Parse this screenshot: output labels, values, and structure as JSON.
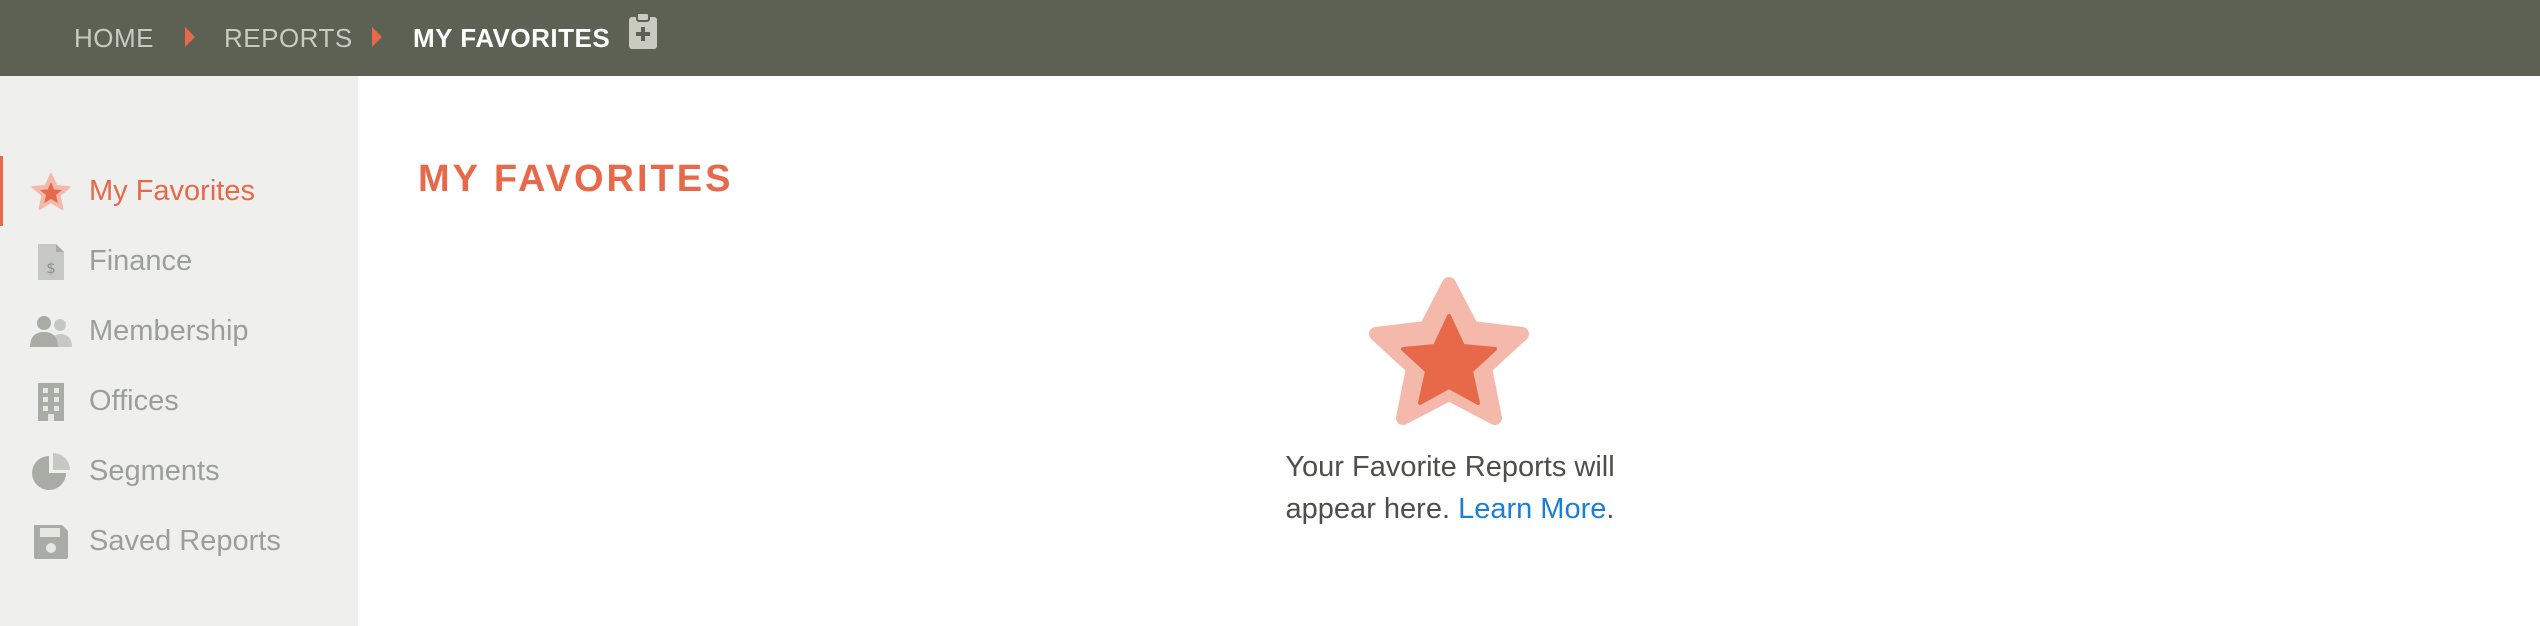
{
  "breadcrumb": {
    "items": [
      {
        "label": "HOME"
      },
      {
        "label": "REPORTS"
      },
      {
        "label": "MY FAVORITES"
      }
    ],
    "add_icon": "clipboard-plus-icon"
  },
  "sidebar": {
    "items": [
      {
        "label": "My Favorites",
        "icon": "star-icon",
        "active": true
      },
      {
        "label": "Finance",
        "icon": "dollar-document-icon",
        "active": false
      },
      {
        "label": "Membership",
        "icon": "users-icon",
        "active": false
      },
      {
        "label": "Offices",
        "icon": "building-icon",
        "active": false
      },
      {
        "label": "Segments",
        "icon": "pie-chart-icon",
        "active": false
      },
      {
        "label": "Saved Reports",
        "icon": "floppy-disk-icon",
        "active": false
      }
    ]
  },
  "main": {
    "title": "MY FAVORITES",
    "empty_state": {
      "icon": "star-icon",
      "message_line1": "Your Favorite Reports will",
      "message_line2": "appear here.",
      "link_label": "Learn More",
      "trailing": "."
    }
  },
  "colors": {
    "topbar": "#5d6154",
    "accent": "#e8694a",
    "accent_light": "#f4b9aa",
    "sidebar_bg": "#efefed",
    "muted_text": "#9c9f99",
    "link": "#1a7fd6"
  }
}
